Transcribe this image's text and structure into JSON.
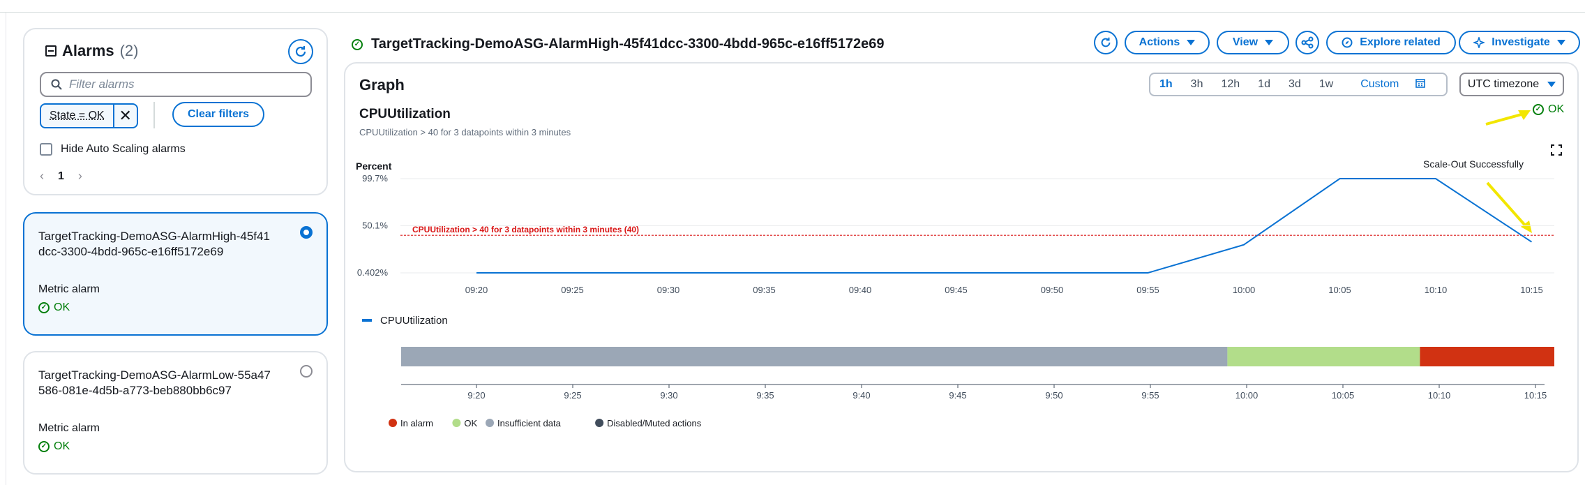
{
  "alarms_panel": {
    "title": "Alarms",
    "count": "(2)",
    "filter_placeholder": "Filter alarms",
    "chip_label": "State = OK",
    "clear_filters": "Clear filters",
    "hide_autoscaling": "Hide Auto Scaling alarms",
    "page": "1"
  },
  "alarm_list": [
    {
      "name": "TargetTracking-DemoASG-AlarmHigh-45f41dcc-3300-4bdd-965c-e16ff5172e69",
      "type": "Metric alarm",
      "status": "OK",
      "selected": true
    },
    {
      "name": "TargetTracking-DemoASG-AlarmLow-55a47586-081e-4d5b-a773-beb880bb6c97",
      "type": "Metric alarm",
      "status": "OK",
      "selected": false
    }
  ],
  "header": {
    "alarm_title": "TargetTracking-DemoASG-AlarmHigh-45f41dcc-3300-4bdd-965c-e16ff5172e69",
    "actions": "Actions",
    "view": "View",
    "explore_related": "Explore related",
    "investigate": "Investigate"
  },
  "graph": {
    "title": "Graph",
    "time_ranges": [
      "1h",
      "3h",
      "12h",
      "1d",
      "3d",
      "1w"
    ],
    "active_range": "1h",
    "custom": "Custom",
    "timezone": "UTC timezone",
    "metric_title": "CPUUtilization",
    "metric_subtitle": "CPUUtilization > 40 for 3 datapoints within 3 minutes",
    "state": "OK",
    "annotation": "Scale-Out Successfully",
    "legend_series": "CPUUtilization"
  },
  "chart_data": [
    {
      "type": "line",
      "ylabel": "Percent",
      "y_ticks": [
        "99.7%",
        "50.1%",
        "0.402%"
      ],
      "ylim": [
        0.402,
        99.7
      ],
      "x_ticks": [
        "09:20",
        "09:25",
        "09:30",
        "09:35",
        "09:40",
        "09:45",
        "09:50",
        "09:55",
        "10:00",
        "10:05",
        "10:10",
        "10:15"
      ],
      "threshold": {
        "value": 40,
        "label": "CPUUtilization > 40 for 3 datapoints within 3 minutes (40)",
        "color": "#d91515"
      },
      "series": [
        {
          "name": "CPUUtilization",
          "color": "#0972d3",
          "points": [
            [
              "09:20",
              0.402
            ],
            [
              "09:55",
              0.402
            ],
            [
              "10:00",
              30
            ],
            [
              "10:05",
              99.7
            ],
            [
              "10:10",
              99.7
            ],
            [
              "10:15",
              33
            ]
          ]
        }
      ],
      "grid": true
    },
    {
      "type": "timeline",
      "x_ticks": [
        "9:20",
        "9:25",
        "9:30",
        "9:35",
        "9:40",
        "9:45",
        "9:50",
        "9:55",
        "10:00",
        "10:05",
        "10:10",
        "10:15"
      ],
      "segments": [
        {
          "state": "Insufficient data",
          "from": "09:15",
          "to": "09:59",
          "color": "#9ba7b6"
        },
        {
          "state": "OK",
          "from": "09:59",
          "to": "10:09",
          "color": "#b2dd8a"
        },
        {
          "state": "In alarm",
          "from": "10:09",
          "to": "10:16",
          "color": "#d13212"
        },
        {
          "state": "OK",
          "from": "10:16",
          "to": "10:16.5",
          "color": "#b2dd8a"
        }
      ],
      "legend": [
        {
          "label": "In alarm",
          "color": "#d13212"
        },
        {
          "label": "OK",
          "color": "#b2dd8a"
        },
        {
          "label": "Insufficient data",
          "color": "#9ba7b6"
        },
        {
          "label": "Disabled/Muted actions",
          "color": "#414d5c"
        }
      ]
    }
  ]
}
